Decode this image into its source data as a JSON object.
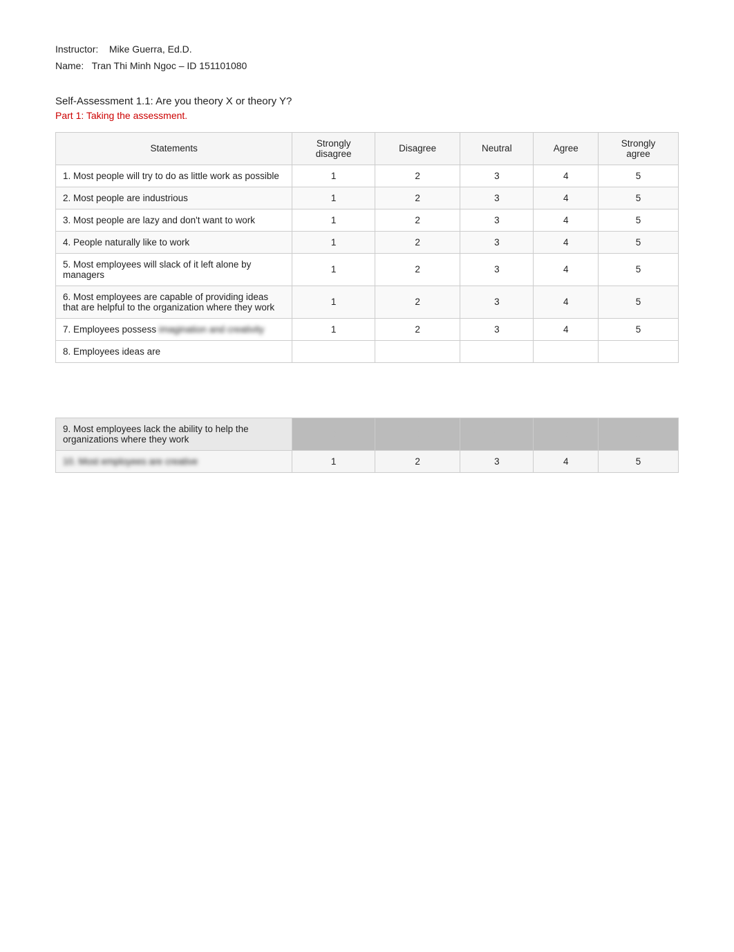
{
  "header": {
    "instructor_label": "Instructor:",
    "instructor_name": "Mike Guerra, Ed.D.",
    "name_label": "Name:",
    "student_name": "Tran Thi Minh Ngoc – ID 151101080"
  },
  "title": {
    "main": "Self-Assessment 1.1: Are you theory X or theory Y?",
    "subtitle": "Part 1: Taking the assessment."
  },
  "table": {
    "headers": [
      "Statements",
      "Strongly disagree",
      "Disagree",
      "Neutral",
      "Agree",
      "Strongly agree"
    ],
    "rows": [
      {
        "id": 1,
        "statement": "1. Most people will try to do as little work as possible",
        "values": [
          "1",
          "2",
          "3",
          "4",
          "5"
        ],
        "blurred": false
      },
      {
        "id": 2,
        "statement": "2. Most people are industrious",
        "values": [
          "1",
          "2",
          "3",
          "4",
          "5"
        ],
        "blurred": false
      },
      {
        "id": 3,
        "statement": "3. Most people are lazy and don't want to work",
        "values": [
          "1",
          "2",
          "3",
          "4",
          "5"
        ],
        "blurred": false
      },
      {
        "id": 4,
        "statement": "4. People naturally like to work",
        "values": [
          "1",
          "2",
          "3",
          "4",
          "5"
        ],
        "blurred": false
      },
      {
        "id": 5,
        "statement": "5. Most employees will slack of it left alone by managers",
        "values": [
          "1",
          "2",
          "3",
          "4",
          "5"
        ],
        "blurred": false
      },
      {
        "id": 6,
        "statement": "6. Most employees are capable of providing ideas that are helpful to the organization where they work",
        "values": [
          "1",
          "2",
          "3",
          "4",
          "5"
        ],
        "blurred": false
      },
      {
        "id": 7,
        "statement": "7. Employees possess imagination and creativity",
        "values": [
          "1",
          "2",
          "3",
          "4",
          "5"
        ],
        "partial_blur_statement": true
      },
      {
        "id": 8,
        "statement": "8. Employees ideas are",
        "values": [
          "",
          "",
          "",
          "",
          ""
        ],
        "row_type": "partial"
      },
      {
        "id": 9,
        "statement": "9. Most employees lack the ability to help the organizations where they work",
        "values": [
          "●",
          "●",
          "●",
          "●",
          "●"
        ],
        "row_type": "blurred_cells"
      },
      {
        "id": 10,
        "statement": "10. Most employees are creative",
        "values": [
          "1",
          "2",
          "3",
          "4",
          "5"
        ],
        "row_type": "blurred_statement"
      }
    ]
  }
}
